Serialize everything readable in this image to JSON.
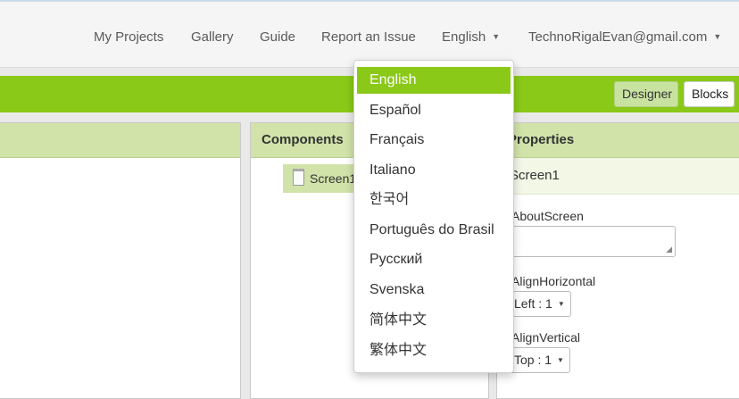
{
  "nav": {
    "my_projects": "My Projects",
    "gallery": "Gallery",
    "guide": "Guide",
    "report": "Report an Issue",
    "language": "English",
    "account": "TechnoRigalEvan@gmail.com"
  },
  "toolbar": {
    "designer": "Designer",
    "blocks": "Blocks"
  },
  "components": {
    "title": "Components",
    "screen_item": "Screen1"
  },
  "properties": {
    "title": "Properties",
    "selected": "Screen1",
    "about_label": "AboutScreen",
    "about_value": "",
    "align_h_label": "AlignHorizontal",
    "align_h_value": "Left : 1",
    "align_v_label": "AlignVertical",
    "align_v_value": "Top : 1"
  },
  "language_menu": {
    "items": [
      "English",
      "Español",
      "Français",
      "Italiano",
      "한국어",
      "Português do Brasil",
      "Русский",
      "Svenska",
      "简体中文",
      "繁体中文"
    ],
    "selected_index": 0
  },
  "colors": {
    "accent_green": "#8ac918",
    "panel_header": "#d1e3a9",
    "designer_active": "#c8e2a0"
  },
  "icons": {
    "component_icon": "document-icon",
    "dropdown_caret": "caret-down-icon",
    "resize": "resize-grip-icon"
  }
}
